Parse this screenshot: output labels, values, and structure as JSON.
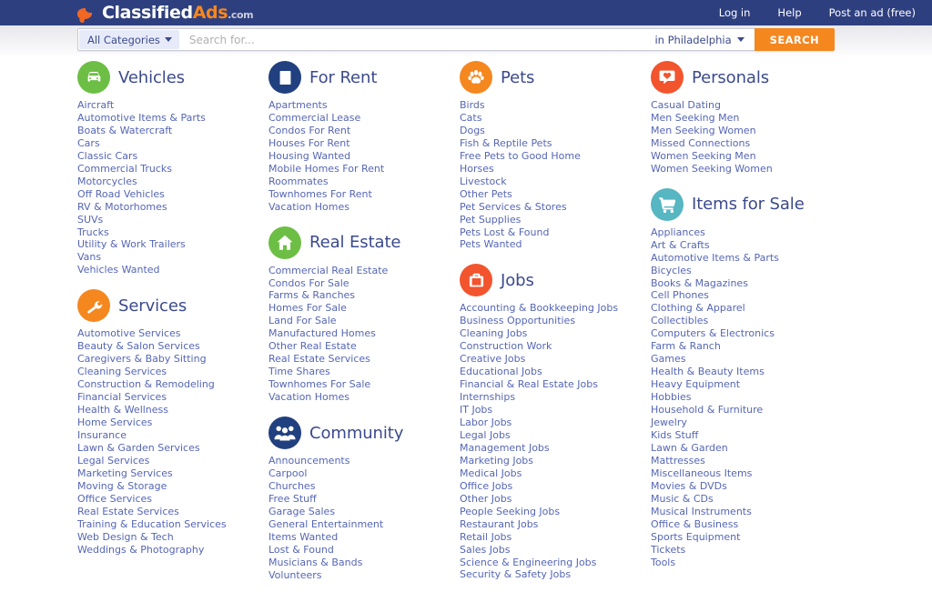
{
  "header": {
    "logo": {
      "icon": "speech-bubble-icon",
      "part_white": "Classified",
      "part_orange": "Ads",
      "part_domain": ".com"
    },
    "nav": [
      {
        "label": "Log in",
        "name": "login-link"
      },
      {
        "label": "Help",
        "name": "help-link"
      },
      {
        "label": "Post an ad (free)",
        "name": "post-ad-link"
      }
    ]
  },
  "search": {
    "category_label": "All Categories",
    "placeholder": "Search for...",
    "value": "",
    "location_label": "in Philadelphia",
    "button_label": "SEARCH"
  },
  "colors": {
    "header_navy": "#2e3f7f",
    "accent_orange": "#f5871f",
    "link_blue": "#5566b5",
    "title_blue": "#3b4a8c",
    "green": "#6dbe45",
    "navy": "#21407f",
    "orange": "#f5871f",
    "red_orange": "#f2542d",
    "teal": "#56b6c2"
  },
  "columns": [
    {
      "name": "column-1",
      "blocks": [
        {
          "title": "Vehicles",
          "icon": "car-icon",
          "color": "#6dbe45",
          "items": [
            "Aircraft",
            "Automotive Items & Parts",
            "Boats & Watercraft",
            "Cars",
            "Classic Cars",
            "Commercial Trucks",
            "Motorcycles",
            "Off Road Vehicles",
            "RV & Motorhomes",
            "SUVs",
            "Trucks",
            "Utility & Work Trailers",
            "Vans",
            "Vehicles Wanted"
          ]
        },
        {
          "title": "Services",
          "icon": "wrench-icon",
          "color": "#f5871f",
          "items": [
            "Automotive Services",
            "Beauty & Salon Services",
            "Caregivers & Baby Sitting",
            "Cleaning Services",
            "Construction & Remodeling",
            "Financial Services",
            "Health & Wellness",
            "Home Services",
            "Insurance",
            "Lawn & Garden Services",
            "Legal Services",
            "Marketing Services",
            "Moving & Storage",
            "Office Services",
            "Real Estate Services",
            "Training & Education Services",
            "Web Design & Tech",
            "Weddings & Photography"
          ]
        }
      ]
    },
    {
      "name": "column-2",
      "blocks": [
        {
          "title": "For Rent",
          "icon": "building-icon",
          "color": "#21407f",
          "items": [
            "Apartments",
            "Commercial Lease",
            "Condos For Rent",
            "Houses For Rent",
            "Housing Wanted",
            "Mobile Homes For Rent",
            "Roommates",
            "Townhomes For Rent",
            "Vacation Homes"
          ]
        },
        {
          "title": "Real Estate",
          "icon": "house-icon",
          "color": "#6dbe45",
          "items": [
            "Commercial Real Estate",
            "Condos For Sale",
            "Farms & Ranches",
            "Homes For Sale",
            "Land For Sale",
            "Manufactured Homes",
            "Other Real Estate",
            "Real Estate Services",
            "Time Shares",
            "Townhomes For Sale",
            "Vacation Homes"
          ]
        },
        {
          "title": "Community",
          "icon": "people-icon",
          "color": "#21407f",
          "items": [
            "Announcements",
            "Carpool",
            "Churches",
            "Free Stuff",
            "Garage Sales",
            "General Entertainment",
            "Items Wanted",
            "Lost & Found",
            "Musicians & Bands",
            "Volunteers"
          ]
        }
      ]
    },
    {
      "name": "column-3",
      "blocks": [
        {
          "title": "Pets",
          "icon": "paw-icon",
          "color": "#f5871f",
          "items": [
            "Birds",
            "Cats",
            "Dogs",
            "Fish & Reptile Pets",
            "Free Pets to Good Home",
            "Horses",
            "Livestock",
            "Other Pets",
            "Pet Services & Stores",
            "Pet Supplies",
            "Pets Lost & Found",
            "Pets Wanted"
          ]
        },
        {
          "title": "Jobs",
          "icon": "briefcase-icon",
          "color": "#f2542d",
          "items": [
            "Accounting & Bookkeeping Jobs",
            "Business Opportunities",
            "Cleaning Jobs",
            "Construction Work",
            "Creative Jobs",
            "Educational Jobs",
            "Financial & Real Estate Jobs",
            "Internships",
            "IT Jobs",
            "Labor Jobs",
            "Legal Jobs",
            "Management Jobs",
            "Marketing Jobs",
            "Medical Jobs",
            "Office Jobs",
            "Other Jobs",
            "People Seeking Jobs",
            "Restaurant Jobs",
            "Retail Jobs",
            "Sales Jobs",
            "Science & Engineering Jobs",
            "Security & Safety Jobs"
          ]
        }
      ]
    },
    {
      "name": "column-4",
      "blocks": [
        {
          "title": "Personals",
          "icon": "heart-bubble-icon",
          "color": "#f2542d",
          "items": [
            "Casual Dating",
            "Men Seeking Men",
            "Men Seeking Women",
            "Missed Connections",
            "Women Seeking Men",
            "Women Seeking Women"
          ]
        },
        {
          "title": "Items for Sale",
          "icon": "shopping-cart-icon",
          "color": "#56b6c2",
          "items": [
            "Appliances",
            "Art & Crafts",
            "Automotive Items & Parts",
            "Bicycles",
            "Books & Magazines",
            "Cell Phones",
            "Clothing & Apparel",
            "Collectibles",
            "Computers & Electronics",
            "Farm & Ranch",
            "Games",
            "Health & Beauty Items",
            "Heavy Equipment",
            "Hobbies",
            "Household & Furniture",
            "Jewelry",
            "Kids Stuff",
            "Lawn & Garden",
            "Mattresses",
            "Miscellaneous Items",
            "Movies & DVDs",
            "Music & CDs",
            "Musical Instruments",
            "Office & Business",
            "Sports Equipment",
            "Tickets",
            "Tools"
          ]
        }
      ]
    }
  ]
}
